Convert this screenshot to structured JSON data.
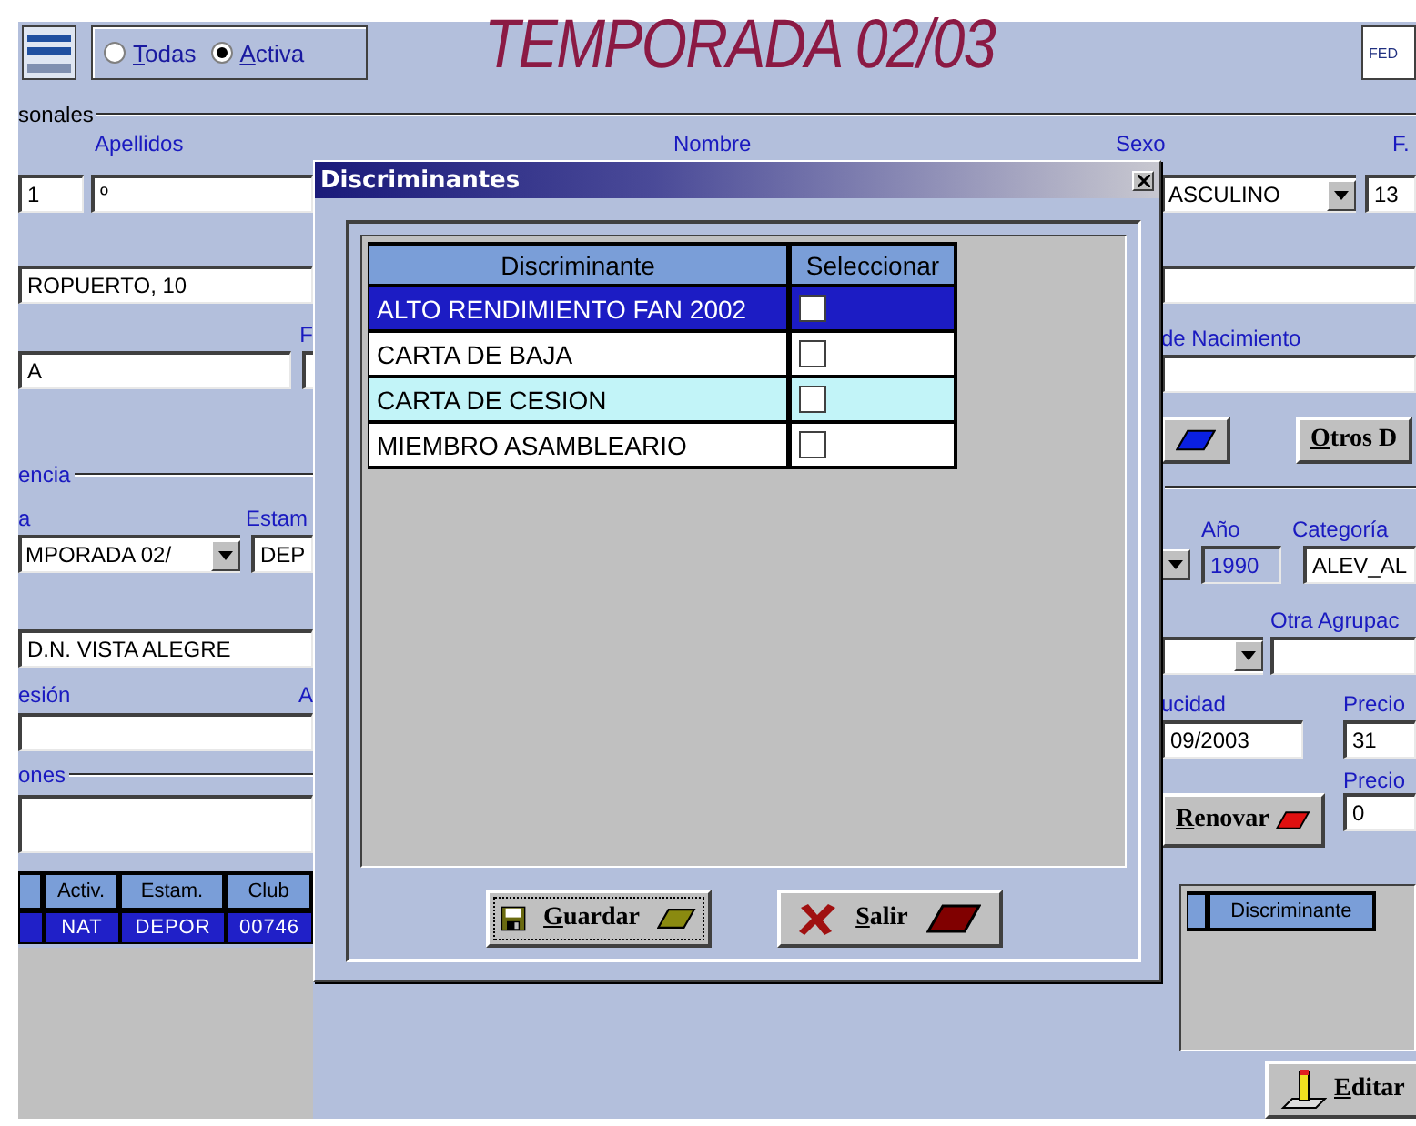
{
  "header": {
    "radios": [
      {
        "label": "Todas",
        "selected": false
      },
      {
        "label": "Activa",
        "selected": true
      }
    ],
    "title": "TEMPORADA 02/03",
    "logo_text": "FED"
  },
  "personal": {
    "legend": "sonales",
    "labels": [
      "Apellidos",
      "Nombre",
      "Sexo",
      "F."
    ],
    "numero": "1",
    "apellidos": "º",
    "sexo": "ASCULINO",
    "fecha": "13",
    "domicilio": "ROPUERTO, 10",
    "label_f": "F",
    "poblacion": "A",
    "nacimiento_label": "de Nacimiento",
    "otros_button": "Otros D"
  },
  "licencia": {
    "legend": "encia",
    "temporada_label": "a",
    "estamento_label": "Estam",
    "temporada": "MPORADA 02/",
    "estamento": "DEP",
    "anio_label": "Año",
    "anio": "1990",
    "categoria_label": "Categoría",
    "categoria": "ALEV_AL",
    "club": "D.N. VISTA ALEGRE",
    "otra_label": "Otra Agrupac",
    "expedicion_label": "esión",
    "label_a": "A",
    "caducidad_label": "ucidad",
    "caducidad": "09/2003",
    "precio_label": "Precio",
    "precio": "31",
    "precio2_label": "Precio",
    "precio2": "0",
    "observaciones_label": "ones",
    "renovar_button": "Renovar"
  },
  "licencias_table": {
    "columns": [
      "Activ.",
      "Estam.",
      "Club"
    ],
    "rows": [
      {
        "cells": [
          "NAT",
          "DEPOR",
          "00746"
        ],
        "selected": true
      }
    ]
  },
  "discriminantes_panel": {
    "columns": [
      "Discriminante"
    ],
    "editar_button": "Editar"
  },
  "dialog": {
    "title": "Discriminantes",
    "columns": [
      "Discriminante",
      "Seleccionar"
    ],
    "rows": [
      {
        "name": "ALTO RENDIMIENTO FAN 2002",
        "checked": false,
        "selected": true
      },
      {
        "name": "CARTA DE BAJA",
        "checked": false,
        "selected": false
      },
      {
        "name": "CARTA DE CESION",
        "checked": false,
        "selected": false
      },
      {
        "name": "MIEMBRO ASAMBLEARIO",
        "checked": false,
        "selected": false
      }
    ],
    "buttons": [
      {
        "label": "Guardar",
        "kind": "save",
        "focused": true
      },
      {
        "label": "Salir",
        "kind": "exit",
        "focused": false
      }
    ]
  }
}
